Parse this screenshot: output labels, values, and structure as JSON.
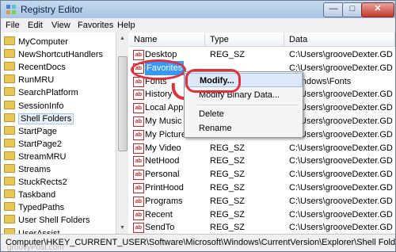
{
  "window": {
    "title": "Registry Editor",
    "min_glyph": "—",
    "max_glyph": "□",
    "close_glyph": "✕"
  },
  "menu": [
    "File",
    "Edit",
    "View",
    "Favorites",
    "Help"
  ],
  "tree": {
    "items": [
      "MyComputer",
      "NewShortcutHandlers",
      "RecentDocs",
      "RunMRU",
      "SearchPlatform",
      "SessionInfo",
      "Shell Folders",
      "StartPage",
      "StartPage2",
      "StreamMRU",
      "Streams",
      "StuckRects2",
      "Taskband",
      "TypedPaths",
      "User Shell Folders",
      "UserAssist"
    ],
    "selected_index": 6
  },
  "list": {
    "columns": [
      "Name",
      "Type",
      "Data"
    ],
    "icon_glyph": "ab",
    "rows": [
      {
        "name": "Desktop",
        "type": "REG_SZ",
        "data": "C:\\Users\\grooveDexter.GD"
      },
      {
        "name": "Favorites",
        "type": "",
        "data": "C:\\Users\\grooveDexter.GD"
      },
      {
        "name": "Fonts",
        "type": "",
        "data": "\\Windows\\Fonts"
      },
      {
        "name": "History",
        "type": "",
        "data": "C:\\Users\\grooveDexter.GD"
      },
      {
        "name": "Local AppData",
        "type": "",
        "data": "C:\\Users\\grooveDexter.GD"
      },
      {
        "name": "My Music",
        "type": "",
        "data": "C:\\Users\\grooveDexter.GD"
      },
      {
        "name": "My Pictures",
        "type": "",
        "data": "C:\\Users\\grooveDexter.GD"
      },
      {
        "name": "My Video",
        "type": "REG_SZ",
        "data": "C:\\Users\\grooveDexter.GD"
      },
      {
        "name": "NetHood",
        "type": "REG_SZ",
        "data": "C:\\Users\\grooveDexter.GD"
      },
      {
        "name": "Personal",
        "type": "REG_SZ",
        "data": "C:\\Users\\grooveDexter.GD"
      },
      {
        "name": "PrintHood",
        "type": "REG_SZ",
        "data": "C:\\Users\\grooveDexter.GD"
      },
      {
        "name": "Programs",
        "type": "REG_SZ",
        "data": "C:\\Users\\grooveDexter.GD"
      },
      {
        "name": "Recent",
        "type": "REG_SZ",
        "data": "C:\\Users\\grooveDexter.GD"
      },
      {
        "name": "SendTo",
        "type": "REG_SZ",
        "data": "C:\\Users\\grooveDexter.GD"
      }
    ],
    "selected_index": 1
  },
  "context_menu": {
    "modify": "Modify...",
    "modify_binary": "Modify Binary Data...",
    "delete": "Delete",
    "rename": "Rename"
  },
  "status": "Computer\\HKEY_CURRENT_USER\\Software\\Microsoft\\Windows\\CurrentVersion\\Explorer\\Shell Folders",
  "watermark": "groovyPost.com",
  "colors": {
    "highlight": "#3399ff",
    "annotation": "#e0303c"
  }
}
